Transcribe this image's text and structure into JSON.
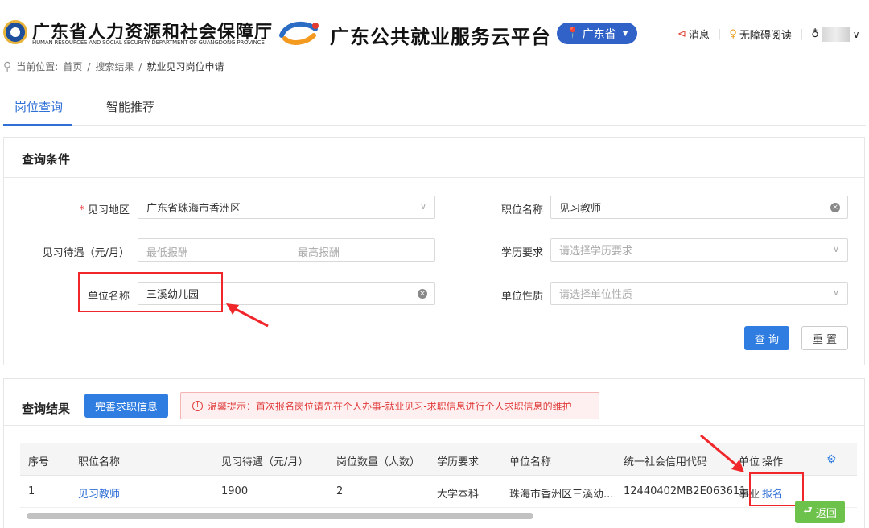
{
  "header": {
    "dept_name": "广东省人力资源和社会保障厅",
    "dept_name_en": "HUMAN RESOURCES AND SOCIAL SECURITY DEPARTMENT OF GUANGDONG PROVINCE",
    "platform_name": "广东公共就业服务云平台",
    "region": "广东省",
    "messages_label": "消息",
    "accessibility_label": "无障碍阅读"
  },
  "breadcrumb": {
    "prefix": "当前位置:",
    "items": [
      "首页",
      "搜索结果",
      "就业见习岗位申请"
    ]
  },
  "tabs": [
    {
      "label": "岗位查询",
      "active": true
    },
    {
      "label": "智能推荐",
      "active": false
    }
  ],
  "conditions": {
    "title": "查询条件",
    "area_label": "见习地区",
    "area_value": "广东省珠海市香洲区",
    "salary_label": "见习待遇（元/月）",
    "salary_min_placeholder": "最低报酬",
    "salary_max_placeholder": "最高报酬",
    "company_label": "单位名称",
    "company_value": "三溪幼儿园",
    "position_label": "职位名称",
    "position_value": "见习教师",
    "education_label": "学历要求",
    "education_placeholder": "请选择学历要求",
    "nature_label": "单位性质",
    "nature_placeholder": "请选择单位性质",
    "search_button": "查 询",
    "reset_button": "重 置"
  },
  "results": {
    "title": "查询结果",
    "complete_info_button": "完善求职信息",
    "tip": "温馨提示：首次报名岗位请先在个人办事-就业见习-求职信息进行个人求职信息的维护",
    "columns": [
      "序号",
      "职位名称",
      "见习待遇（元/月）",
      "岗位数量（人数）",
      "学历要求",
      "单位名称",
      "统一社会信用代码",
      "单位",
      "操作"
    ],
    "rows": [
      {
        "index": "1",
        "position": "见习教师",
        "salary": "1900",
        "count": "2",
        "education": "大学本科",
        "company": "珠海市香洲区三溪幼...",
        "credit_code": "12440402MB2E063611",
        "unit_nature": "事业",
        "action": "报名"
      }
    ]
  },
  "back_button": "返回",
  "colors": {
    "primary": "#2f7de1",
    "link": "#2f6fd6",
    "annotation_red": "#f0262b",
    "back_green": "#6cc24a"
  },
  "icons": {
    "dept_logo": "dept-emblem-icon",
    "platform_logo": "cloud-platform-logo",
    "location": "map-pin-icon",
    "message": "megaphone-icon",
    "accessibility": "bulb-icon",
    "user": "user-icon",
    "settings": "gear-icon"
  }
}
